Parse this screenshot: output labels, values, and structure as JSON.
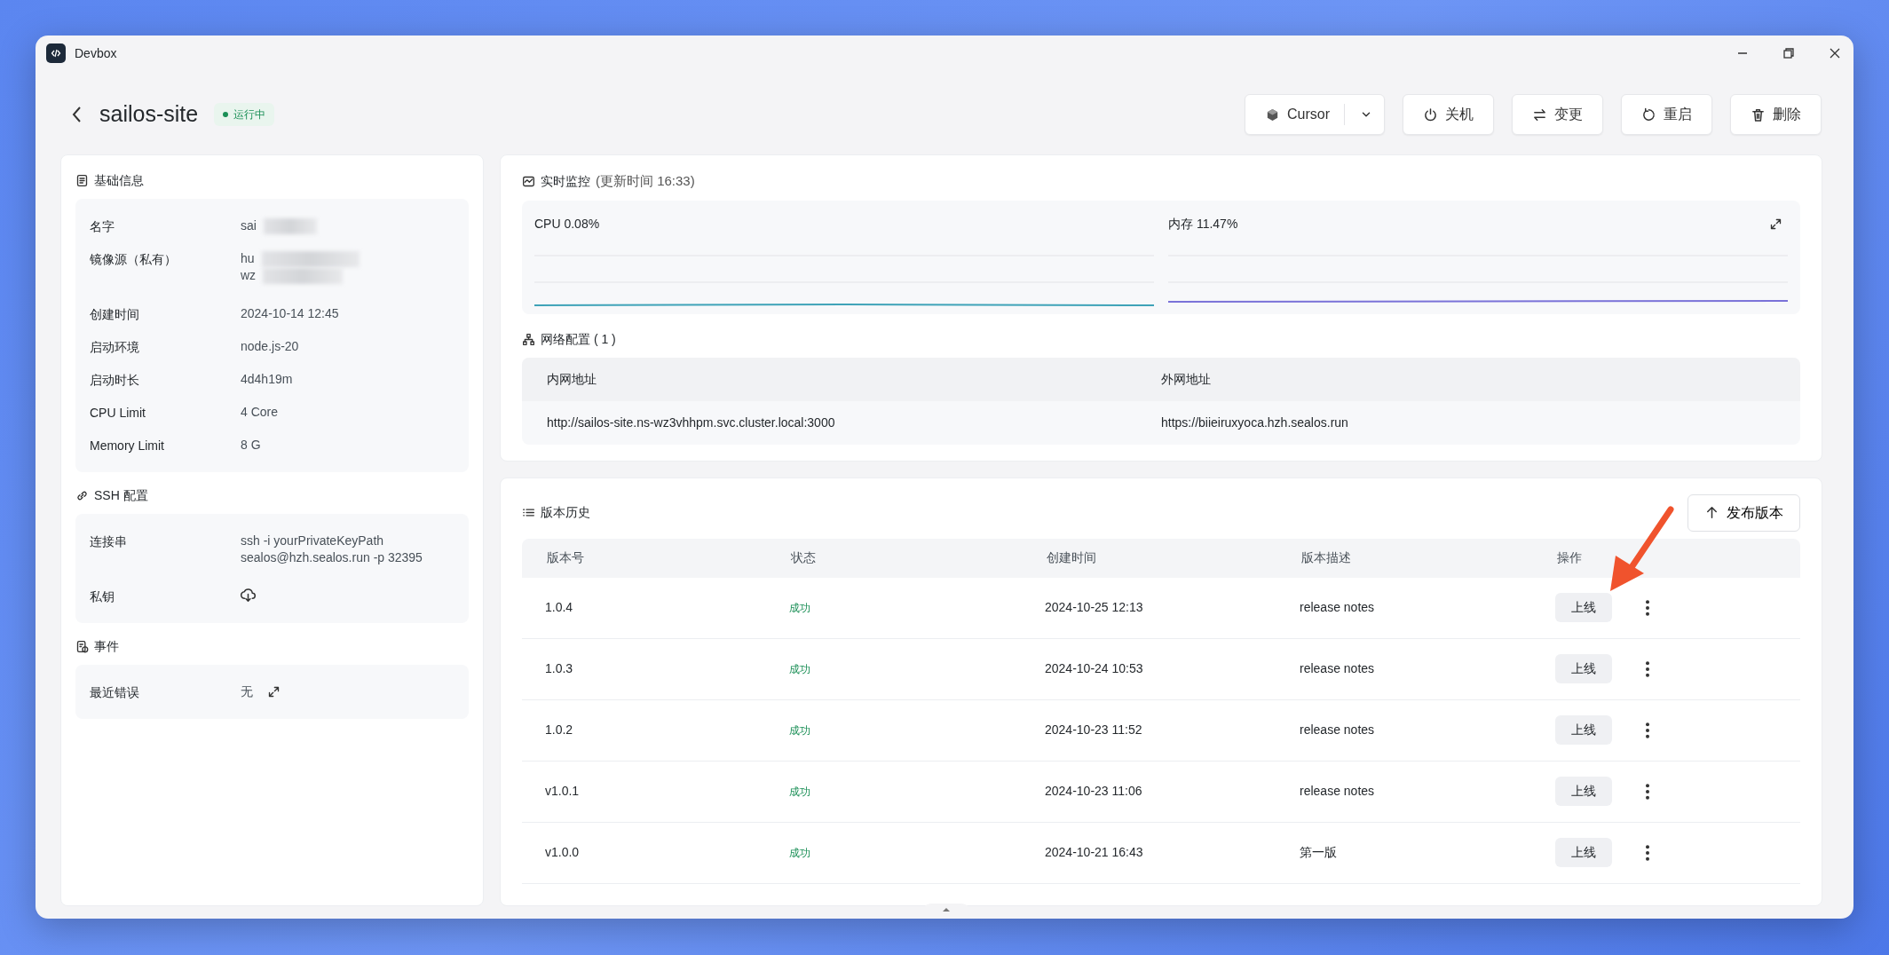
{
  "window": {
    "title": "Devbox"
  },
  "header": {
    "name": "sailos-site",
    "status": "运行中",
    "actions": [
      {
        "kind": "ide",
        "label": "Cursor"
      },
      {
        "kind": "power",
        "label": "关机"
      },
      {
        "kind": "swap",
        "label": "变更"
      },
      {
        "kind": "restart",
        "label": "重启"
      },
      {
        "kind": "delete",
        "label": "删除"
      }
    ]
  },
  "basic_info": {
    "title": "基础信息",
    "fields": [
      {
        "label": "名字",
        "kind": "text",
        "lines": [
          "sai"
        ],
        "redacted": true
      },
      {
        "label": "镜像源（私有）",
        "kind": "text",
        "lines": [
          "hu",
          "wz"
        ],
        "redacted": true
      },
      {
        "label": "创建时间",
        "kind": "text",
        "lines": [
          "2024-10-14 12:45"
        ],
        "redacted": false
      },
      {
        "label": "启动环境",
        "kind": "text",
        "lines": [
          "node.js-20"
        ],
        "redacted": false
      },
      {
        "label": "启动时长",
        "kind": "text",
        "lines": [
          "4d4h19m"
        ],
        "redacted": false
      },
      {
        "label": "CPU Limit",
        "kind": "text",
        "lines": [
          "4 Core"
        ],
        "redacted": false
      },
      {
        "label": "Memory Limit",
        "kind": "text",
        "lines": [
          "8 G"
        ],
        "redacted": false
      }
    ]
  },
  "ssh": {
    "title": "SSH 配置",
    "fields": [
      {
        "label": "连接串",
        "kind": "text",
        "lines": [
          "ssh -i yourPrivateKeyPath",
          "sealos@hzh.sealos.run -p 32395"
        ],
        "redacted": false
      },
      {
        "label": "私钥",
        "kind": "download"
      }
    ]
  },
  "events": {
    "title": "事件",
    "fields": [
      {
        "label": "最近错误",
        "kind": "expand",
        "lines": [
          "无"
        ],
        "redacted": false
      }
    ]
  },
  "monitor": {
    "title": "实时监控",
    "updated": "(更新时间  16:33)",
    "metrics": [
      {
        "label": "CPU 0.08%",
        "color": "#3fa3b8"
      },
      {
        "label": "内存 11.47%",
        "color": "#7a72d8"
      }
    ]
  },
  "network": {
    "title": "网络配置 ( 1 )",
    "columns": [
      "内网地址",
      "外网地址"
    ],
    "rows": [
      [
        "http://sailos-site.ns-wz3vhhpm.svc.cluster.local:3000",
        "https://biieiruxyoca.hzh.sealos.run"
      ]
    ]
  },
  "versions": {
    "title": "版本历史",
    "publish": "发布版本",
    "columns": [
      "版本号",
      "状态",
      "创建时间",
      "版本描述",
      "操作"
    ],
    "rows": [
      {
        "version": "1.0.4",
        "status": "成功",
        "created": "2024-10-25 12:13",
        "description": "release notes",
        "action": "上线"
      },
      {
        "version": "1.0.3",
        "status": "成功",
        "created": "2024-10-24 10:53",
        "description": "release notes",
        "action": "上线"
      },
      {
        "version": "1.0.2",
        "status": "成功",
        "created": "2024-10-23 11:52",
        "description": "release notes",
        "action": "上线"
      },
      {
        "version": "v1.0.1",
        "status": "成功",
        "created": "2024-10-23 11:06",
        "description": "release notes",
        "action": "上线"
      },
      {
        "version": "v1.0.0",
        "status": "成功",
        "created": "2024-10-21 16:43",
        "description": "第一版",
        "action": "上线"
      }
    ]
  }
}
